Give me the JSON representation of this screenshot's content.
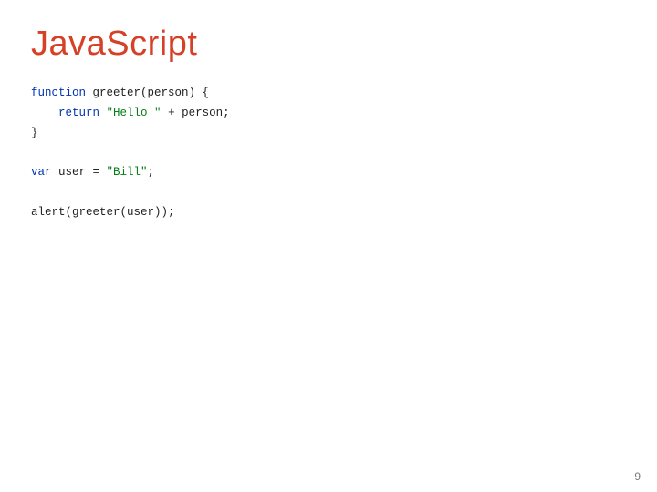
{
  "title": "JavaScript",
  "code": {
    "kw_function": "function",
    "fn_signature": " greeter(person) {",
    "indent": "    ",
    "kw_return": "return",
    "sp": " ",
    "str_hello": "\"Hello \"",
    "ret_tail": " + person;",
    "close_brace": "}",
    "kw_var": "var",
    "var_decl": " user = ",
    "str_bill": "\"Bill\"",
    "semicolon": ";",
    "alert_call": "alert(greeter(user));"
  },
  "page_number": "9"
}
